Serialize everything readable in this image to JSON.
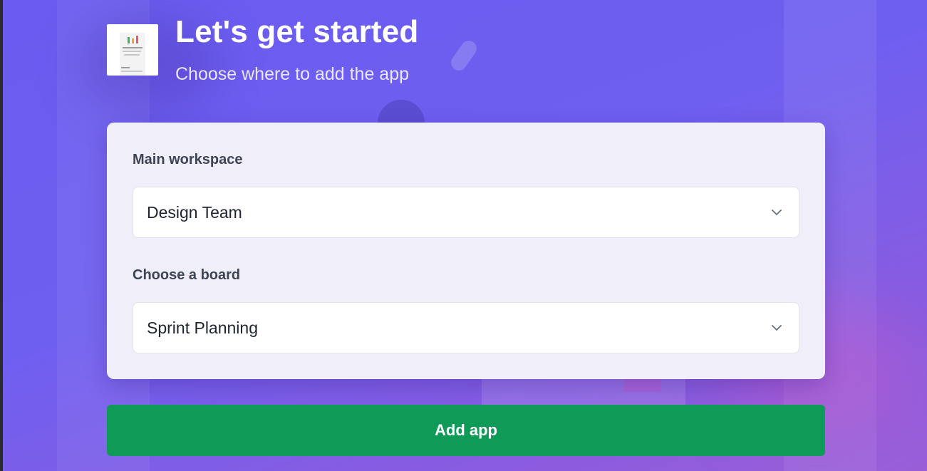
{
  "header": {
    "title": "Let's get started",
    "subtitle": "Choose where to add the app",
    "thumbnail_icon": "app-preview-thumbnail"
  },
  "form": {
    "workspace": {
      "label": "Main workspace",
      "selected": "Design Team",
      "icon": "chevron-down-icon"
    },
    "board": {
      "label": "Choose a board",
      "selected": "Sprint Planning",
      "icon": "chevron-down-icon"
    }
  },
  "actions": {
    "add_label": "Add app"
  },
  "colors": {
    "background_start": "#6a5cf0",
    "background_end": "#9a5ed8",
    "card": "#f0eef8",
    "primary_button": "#0f9a57",
    "label_text": "#3d4454",
    "value_text": "#1f2430"
  }
}
